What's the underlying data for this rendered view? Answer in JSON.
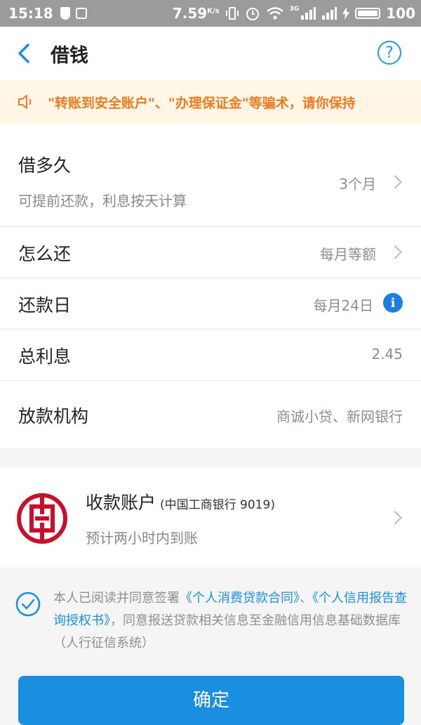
{
  "status_bar": {
    "time": "15:18",
    "speed": "7.59",
    "speed_unit": "K/s",
    "network": "3G",
    "battery": "100"
  },
  "app_bar": {
    "title": "借钱"
  },
  "notice": {
    "text": "\"转账到安全账户\"、\"办理保证金\"等骗术，请你保持"
  },
  "loan": {
    "term": {
      "label": "借多久",
      "sub": "可提前还款，利息按天计算",
      "value": "3个月"
    },
    "repay_method": {
      "label": "怎么还",
      "value": "每月等额"
    },
    "repay_day": {
      "label": "还款日",
      "value": "每月24日"
    },
    "total_interest": {
      "label": "总利息",
      "value": "2.45"
    },
    "institution": {
      "label": "放款机构",
      "value": "商诚小贷、新网银行"
    }
  },
  "account": {
    "label": "收款账户",
    "bank": "(中国工商银行 9019)",
    "sub": "预计两小时内到账"
  },
  "agreement": {
    "prefix": "本人已阅读并同意签署",
    "link1": "《个人消费贷款合同》",
    "sep": "、",
    "link2": "《个人信用报告查询授权书》",
    "suffix": "，同意报送贷款相关信息至金融信用信息基础数据库（人行征信系统）"
  },
  "confirm_button": {
    "label": "确定"
  },
  "colors": {
    "accent": "#1a8fe0",
    "warning": "#ef7b21",
    "bank_red": "#c8102e"
  }
}
